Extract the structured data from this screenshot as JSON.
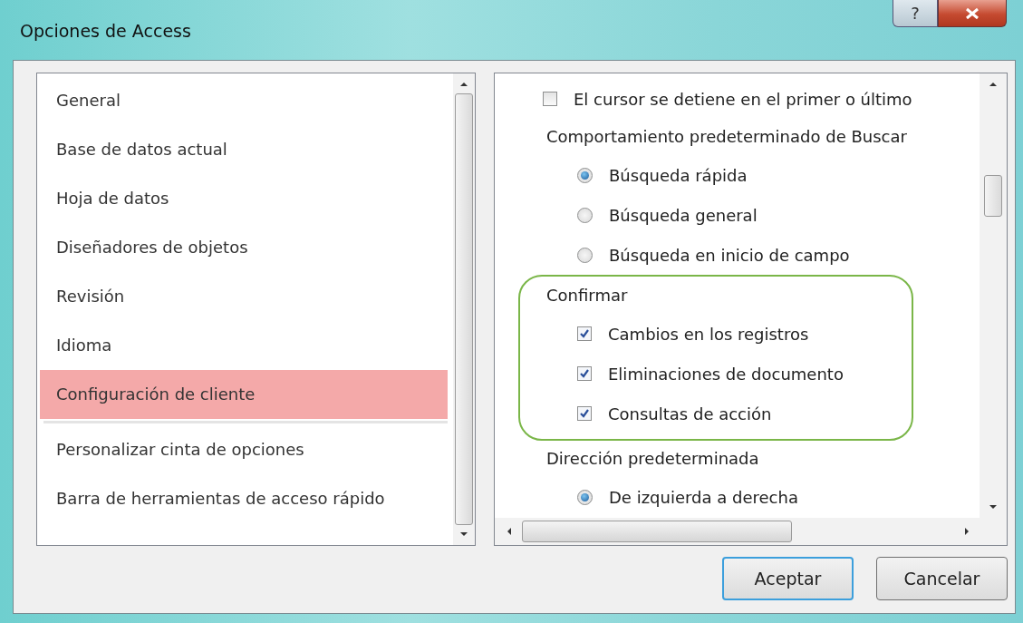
{
  "window": {
    "title": "Opciones de Access",
    "help_label": "?"
  },
  "sidebar": {
    "groups": [
      [
        {
          "label": "General",
          "selected": false
        },
        {
          "label": "Base de datos actual",
          "selected": false
        },
        {
          "label": "Hoja de datos",
          "selected": false
        },
        {
          "label": "Diseñadores de objetos",
          "selected": false
        },
        {
          "label": "Revisión",
          "selected": false
        },
        {
          "label": "Idioma",
          "selected": false
        },
        {
          "label": "Configuración de cliente",
          "selected": true
        }
      ],
      [
        {
          "label": "Personalizar cinta de opciones",
          "selected": false
        },
        {
          "label": "Barra de herramientas de acceso rápido",
          "selected": false
        }
      ]
    ]
  },
  "options": [
    {
      "kind": "checkbox",
      "label": "El cursor se detiene en el primer o último",
      "checked": false
    },
    {
      "kind": "heading",
      "label": "Comportamiento predeterminado de Buscar"
    },
    {
      "kind": "radio",
      "label": "Búsqueda rápida",
      "selected": true
    },
    {
      "kind": "radio",
      "label": "Búsqueda general",
      "selected": false
    },
    {
      "kind": "radio",
      "label": "Búsqueda en inicio de campo",
      "selected": false
    },
    {
      "kind": "group",
      "label": "Confirmar",
      "highlighted": true,
      "children": [
        {
          "kind": "checkbox",
          "label": "Cambios en los registros",
          "checked": true
        },
        {
          "kind": "checkbox",
          "label": "Eliminaciones de documento",
          "checked": true
        },
        {
          "kind": "checkbox",
          "label": "Consultas de acción",
          "checked": true
        }
      ]
    },
    {
      "kind": "heading",
      "label": "Dirección predeterminada"
    },
    {
      "kind": "radio",
      "label": "De izquierda a derecha",
      "selected": true
    }
  ],
  "buttons": [
    {
      "label": "Aceptar",
      "default": true
    },
    {
      "label": "Cancelar",
      "default": false
    }
  ]
}
